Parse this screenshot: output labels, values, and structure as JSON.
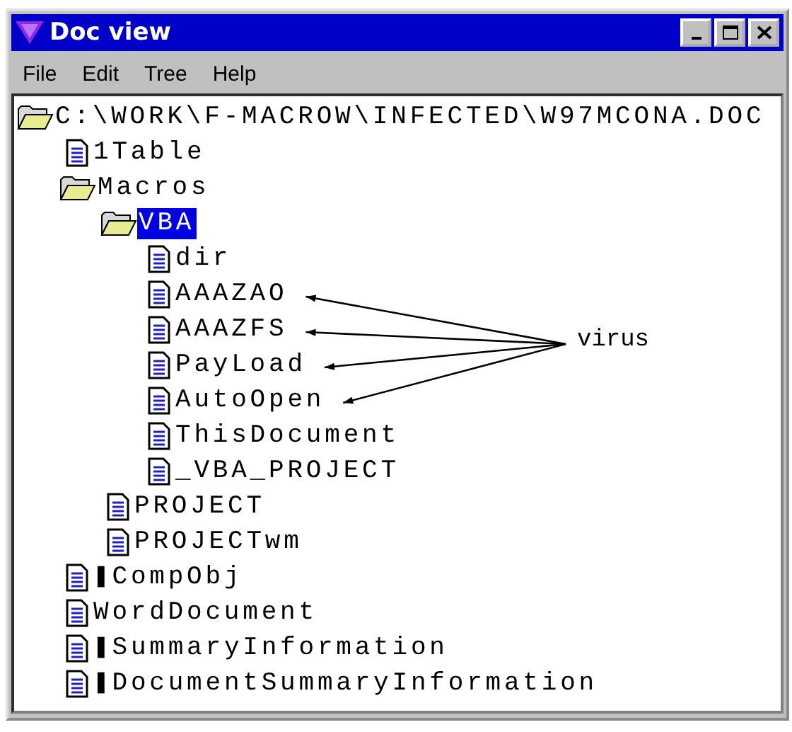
{
  "window": {
    "title": "Doc view"
  },
  "menu": [
    {
      "label": "File"
    },
    {
      "label": "Edit"
    },
    {
      "label": "Tree"
    },
    {
      "label": "Help"
    }
  ],
  "annotation_label": "virus",
  "tree": [
    {
      "label": "C:\\WORK\\F-MACROW\\INFECTED\\W97MCONA.DOC",
      "kind": "folder",
      "expanded": true,
      "selected": false,
      "virus_arrow": false,
      "children": [
        {
          "label": "1Table",
          "kind": "file",
          "selected": false,
          "virus_arrow": false
        },
        {
          "label": "Macros",
          "kind": "folder",
          "expanded": true,
          "selected": false,
          "virus_arrow": false,
          "children": [
            {
              "label": "VBA",
              "kind": "folder",
              "expanded": true,
              "selected": true,
              "virus_arrow": false,
              "children": [
                {
                  "label": "dir",
                  "kind": "file",
                  "selected": false,
                  "virus_arrow": false
                },
                {
                  "label": "AAAZAO",
                  "kind": "file",
                  "selected": false,
                  "virus_arrow": true
                },
                {
                  "label": "AAAZFS",
                  "kind": "file",
                  "selected": false,
                  "virus_arrow": true
                },
                {
                  "label": "PayLoad",
                  "kind": "file",
                  "selected": false,
                  "virus_arrow": true
                },
                {
                  "label": "AutoOpen",
                  "kind": "file",
                  "selected": false,
                  "virus_arrow": true
                },
                {
                  "label": "ThisDocument",
                  "kind": "file",
                  "selected": false,
                  "virus_arrow": false
                },
                {
                  "label": "_VBA_PROJECT",
                  "kind": "file",
                  "selected": false,
                  "virus_arrow": false
                }
              ]
            },
            {
              "label": "PROJECT",
              "kind": "file",
              "selected": false,
              "virus_arrow": false
            },
            {
              "label": "PROJECTwm",
              "kind": "file",
              "selected": false,
              "virus_arrow": false
            }
          ]
        },
        {
          "label": "❚CompObj",
          "kind": "file",
          "selected": false,
          "virus_arrow": false
        },
        {
          "label": "WordDocument",
          "kind": "file",
          "selected": false,
          "virus_arrow": false
        },
        {
          "label": "❚SummaryInformation",
          "kind": "file",
          "selected": false,
          "virus_arrow": false
        },
        {
          "label": "❚DocumentSummaryInformation",
          "kind": "file",
          "selected": false,
          "virus_arrow": false
        }
      ]
    }
  ]
}
